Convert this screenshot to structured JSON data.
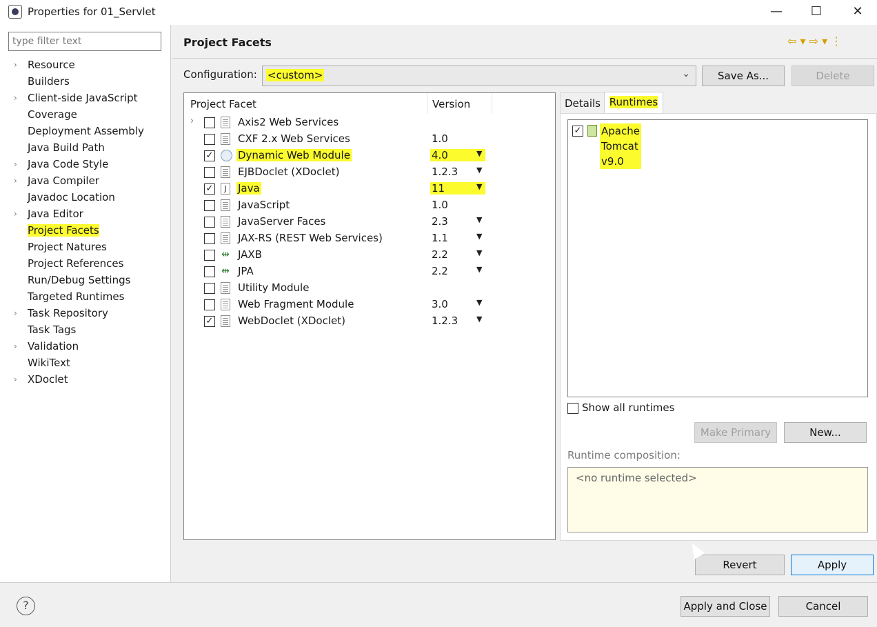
{
  "window": {
    "title": "Properties for 01_Servlet",
    "minimize": "—",
    "maximize": "☐",
    "close": "✕"
  },
  "filter": {
    "placeholder": "type filter text"
  },
  "nav_tree": [
    {
      "label": "Resource",
      "expandable": true
    },
    {
      "label": "Builders",
      "expandable": false
    },
    {
      "label": "Client-side JavaScript",
      "expandable": true
    },
    {
      "label": "Coverage",
      "expandable": false
    },
    {
      "label": "Deployment Assembly",
      "expandable": false
    },
    {
      "label": "Java Build Path",
      "expandable": false
    },
    {
      "label": "Java Code Style",
      "expandable": true
    },
    {
      "label": "Java Compiler",
      "expandable": true
    },
    {
      "label": "Javadoc Location",
      "expandable": false
    },
    {
      "label": "Java Editor",
      "expandable": true
    },
    {
      "label": "Project Facets",
      "expandable": false,
      "selected": true
    },
    {
      "label": "Project Natures",
      "expandable": false
    },
    {
      "label": "Project References",
      "expandable": false
    },
    {
      "label": "Run/Debug Settings",
      "expandable": false
    },
    {
      "label": "Targeted Runtimes",
      "expandable": false
    },
    {
      "label": "Task Repository",
      "expandable": true
    },
    {
      "label": "Task Tags",
      "expandable": false
    },
    {
      "label": "Validation",
      "expandable": true
    },
    {
      "label": "WikiText",
      "expandable": false
    },
    {
      "label": "XDoclet",
      "expandable": true
    }
  ],
  "page": {
    "title": "Project Facets",
    "nav_icons": "⇦ ▾ ⇨ ▾ ⋮"
  },
  "configuration": {
    "label": "Configuration:",
    "value": "<custom>",
    "save_as": "Save As...",
    "delete": "Delete"
  },
  "facets": {
    "col_facet": "Project Facet",
    "col_version": "Version",
    "rows": [
      {
        "name": "Axis2 Web Services",
        "version": "",
        "checked": false,
        "dropdown": false,
        "expandable": true,
        "icon": "doc-icon"
      },
      {
        "name": "CXF 2.x Web Services",
        "version": "1.0",
        "checked": false,
        "dropdown": false,
        "icon": "doc-icon"
      },
      {
        "name": "Dynamic Web Module",
        "version": "4.0",
        "checked": true,
        "dropdown": true,
        "icon": "web-module-icon",
        "highlight": true
      },
      {
        "name": "EJBDoclet (XDoclet)",
        "version": "1.2.3",
        "checked": false,
        "dropdown": true,
        "icon": "doc-icon"
      },
      {
        "name": "Java",
        "version": "11",
        "checked": true,
        "dropdown": true,
        "icon": "java-icon",
        "highlight": true
      },
      {
        "name": "JavaScript",
        "version": "1.0",
        "checked": false,
        "dropdown": false,
        "icon": "doc-icon"
      },
      {
        "name": "JavaServer Faces",
        "version": "2.3",
        "checked": false,
        "dropdown": true,
        "icon": "doc-icon"
      },
      {
        "name": "JAX-RS (REST Web Services)",
        "version": "1.1",
        "checked": false,
        "dropdown": true,
        "icon": "doc-icon"
      },
      {
        "name": "JAXB",
        "version": "2.2",
        "checked": false,
        "dropdown": true,
        "icon": "arrows-icon"
      },
      {
        "name": "JPA",
        "version": "2.2",
        "checked": false,
        "dropdown": true,
        "icon": "arrows-icon"
      },
      {
        "name": "Utility Module",
        "version": "",
        "checked": false,
        "dropdown": false,
        "icon": "doc-icon"
      },
      {
        "name": "Web Fragment Module",
        "version": "3.0",
        "checked": false,
        "dropdown": true,
        "icon": "doc-icon"
      },
      {
        "name": "WebDoclet (XDoclet)",
        "version": "1.2.3",
        "checked": true,
        "dropdown": true,
        "icon": "doc-icon"
      }
    ]
  },
  "tabs": {
    "details": "Details",
    "runtimes": "Runtimes"
  },
  "runtimes": {
    "items": [
      {
        "name": "Apache Tomcat v9.0",
        "checked": true
      }
    ],
    "show_all": "Show all runtimes",
    "make_primary": "Make Primary",
    "new": "New...",
    "composition_label": "Runtime composition:",
    "composition_empty": "<no runtime selected>"
  },
  "buttons": {
    "revert": "Revert",
    "apply": "Apply",
    "apply_and_close": "Apply and Close",
    "cancel": "Cancel",
    "help": "?"
  },
  "colors": {
    "highlight": "#fbfb2e",
    "default_button_border": "#0078d7"
  }
}
